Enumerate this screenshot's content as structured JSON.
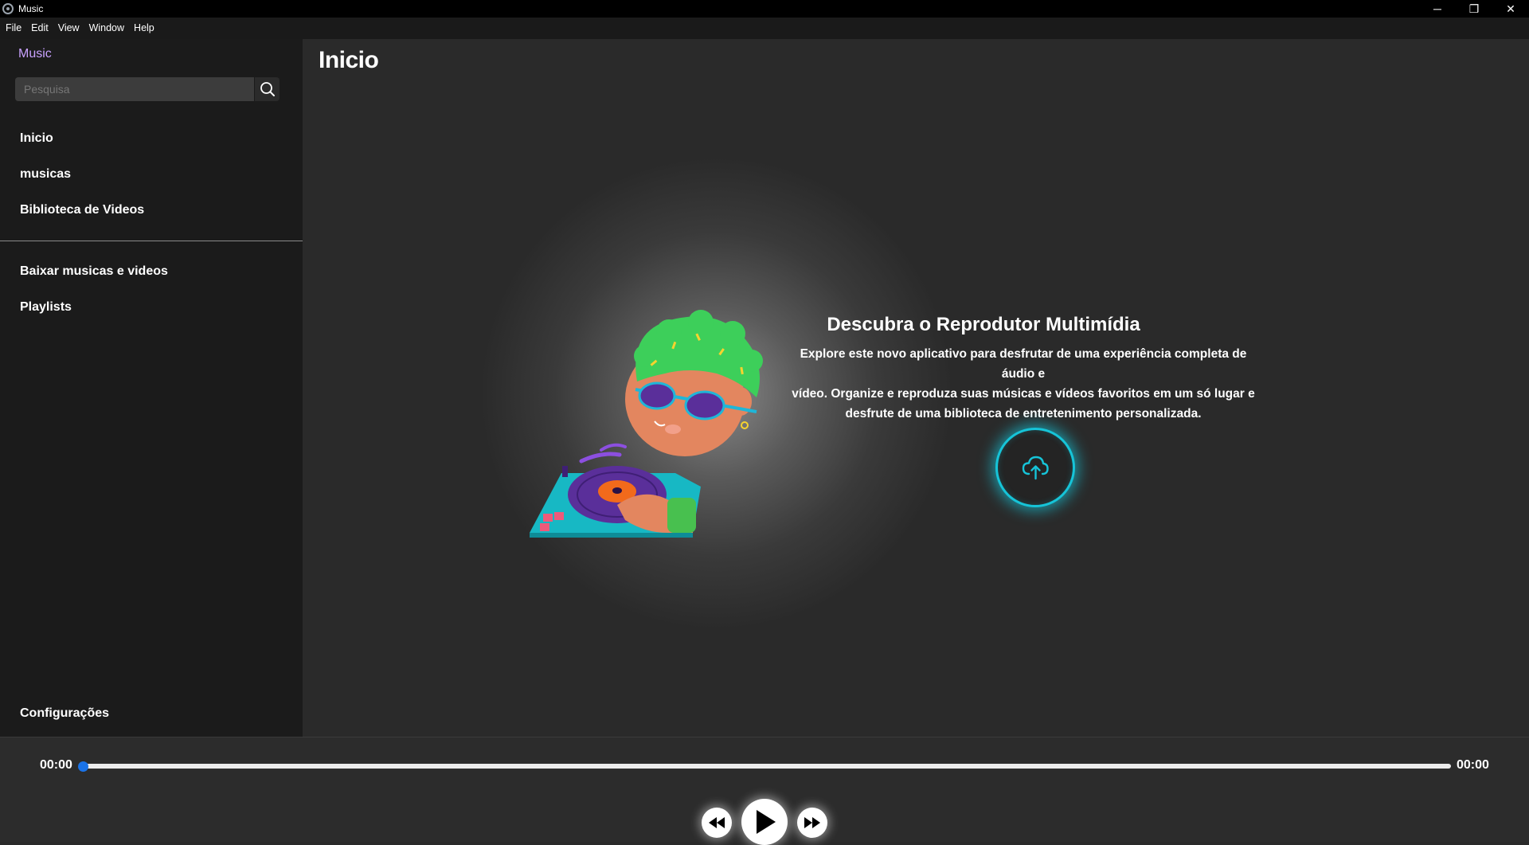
{
  "window": {
    "title": "Music",
    "controls": {
      "minimize": "─",
      "restore": "❐",
      "close": "✕"
    }
  },
  "menubar": [
    "File",
    "Edit",
    "View",
    "Window",
    "Help"
  ],
  "sidebar": {
    "brand": "Music",
    "search": {
      "placeholder": "Pesquisa",
      "value": ""
    },
    "nav_primary": [
      {
        "label": "Inicio",
        "icon": ""
      },
      {
        "label": "musicas",
        "icon": ""
      },
      {
        "label": "Biblioteca de Videos",
        "icon": ""
      }
    ],
    "nav_secondary": [
      {
        "label": "Baixar musicas e videos"
      },
      {
        "label": "Playlists"
      }
    ],
    "settings_label": "Configurações"
  },
  "main": {
    "page_title": "Inicio",
    "hero_title": "Descubra o Reprodutor Multimídia",
    "hero_lines": [
      "Explore este novo aplicativo para desfrutar de uma experiência completa de áudio e",
      "vídeo. Organize e reproduza suas músicas e vídeos favoritos em um só lugar e",
      "desfrute de uma biblioteca de entretenimento personalizada."
    ],
    "upload_icon": "cloud-upload-icon",
    "illustration": "dj-character-illustration"
  },
  "player": {
    "current_time": "00:00",
    "total_time": "00:00",
    "progress": 0,
    "icons": [
      "rewind-icon",
      "play-icon",
      "fast-forward-icon"
    ]
  },
  "colors": {
    "brand": "#c9a2ff",
    "accent_glow": "#16c4d8",
    "progress_thumb": "#1a73e8",
    "sidebar_bg": "#1b1b1b",
    "main_bg": "#2a2a2a"
  }
}
